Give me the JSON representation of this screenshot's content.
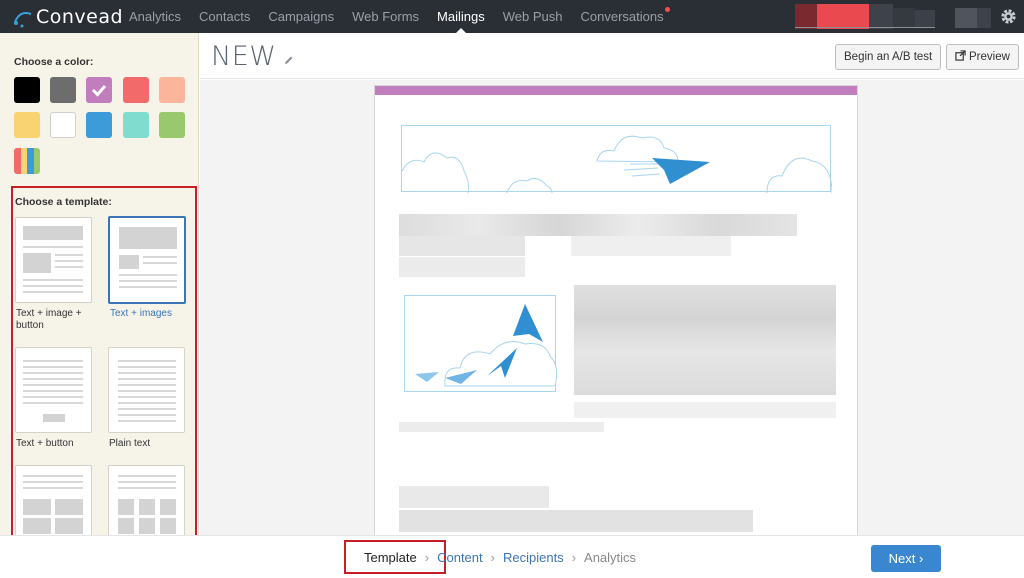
{
  "app": {
    "name": "Convead"
  },
  "nav": {
    "items": [
      {
        "label": "Analytics",
        "active": false
      },
      {
        "label": "Contacts",
        "active": false
      },
      {
        "label": "Campaigns",
        "active": false
      },
      {
        "label": "Web Forms",
        "active": false
      },
      {
        "label": "Mailings",
        "active": true
      },
      {
        "label": "Web Push",
        "active": false
      },
      {
        "label": "Conversations",
        "active": false,
        "notification": true
      }
    ]
  },
  "sidebar": {
    "color_title": "Choose a color:",
    "colors": [
      "#000000",
      "#6d6d6d",
      "#c27dbd",
      "#f36a6a",
      "#fbb59c",
      "#f9d271",
      "#ffffff",
      "#3d9bd9",
      "#7fdccf",
      "#9ac86e",
      "multicolor"
    ],
    "selected_color": "#c27dbd",
    "template_title": "Choose a template:",
    "templates": [
      {
        "label": "Text + image + button",
        "selected": false
      },
      {
        "label": "Text + images",
        "selected": true
      },
      {
        "label": "Text + button",
        "selected": false
      },
      {
        "label": "Plain text",
        "selected": false
      },
      {
        "label": "",
        "selected": false
      },
      {
        "label": "",
        "selected": false
      }
    ]
  },
  "header": {
    "title": "NEW",
    "ab_test_label": "Begin an A/B test",
    "preview_label": "Preview"
  },
  "wizard": {
    "steps": [
      {
        "label": "Template",
        "state": "current"
      },
      {
        "label": "Content",
        "state": "link"
      },
      {
        "label": "Recipients",
        "state": "link"
      },
      {
        "label": "Analytics",
        "state": "disabled"
      }
    ],
    "next_label": "Next ›"
  },
  "icons": {
    "gear": "gear-icon",
    "pencil": "pencil-icon",
    "external": "external-link-icon",
    "check": "check-icon"
  }
}
